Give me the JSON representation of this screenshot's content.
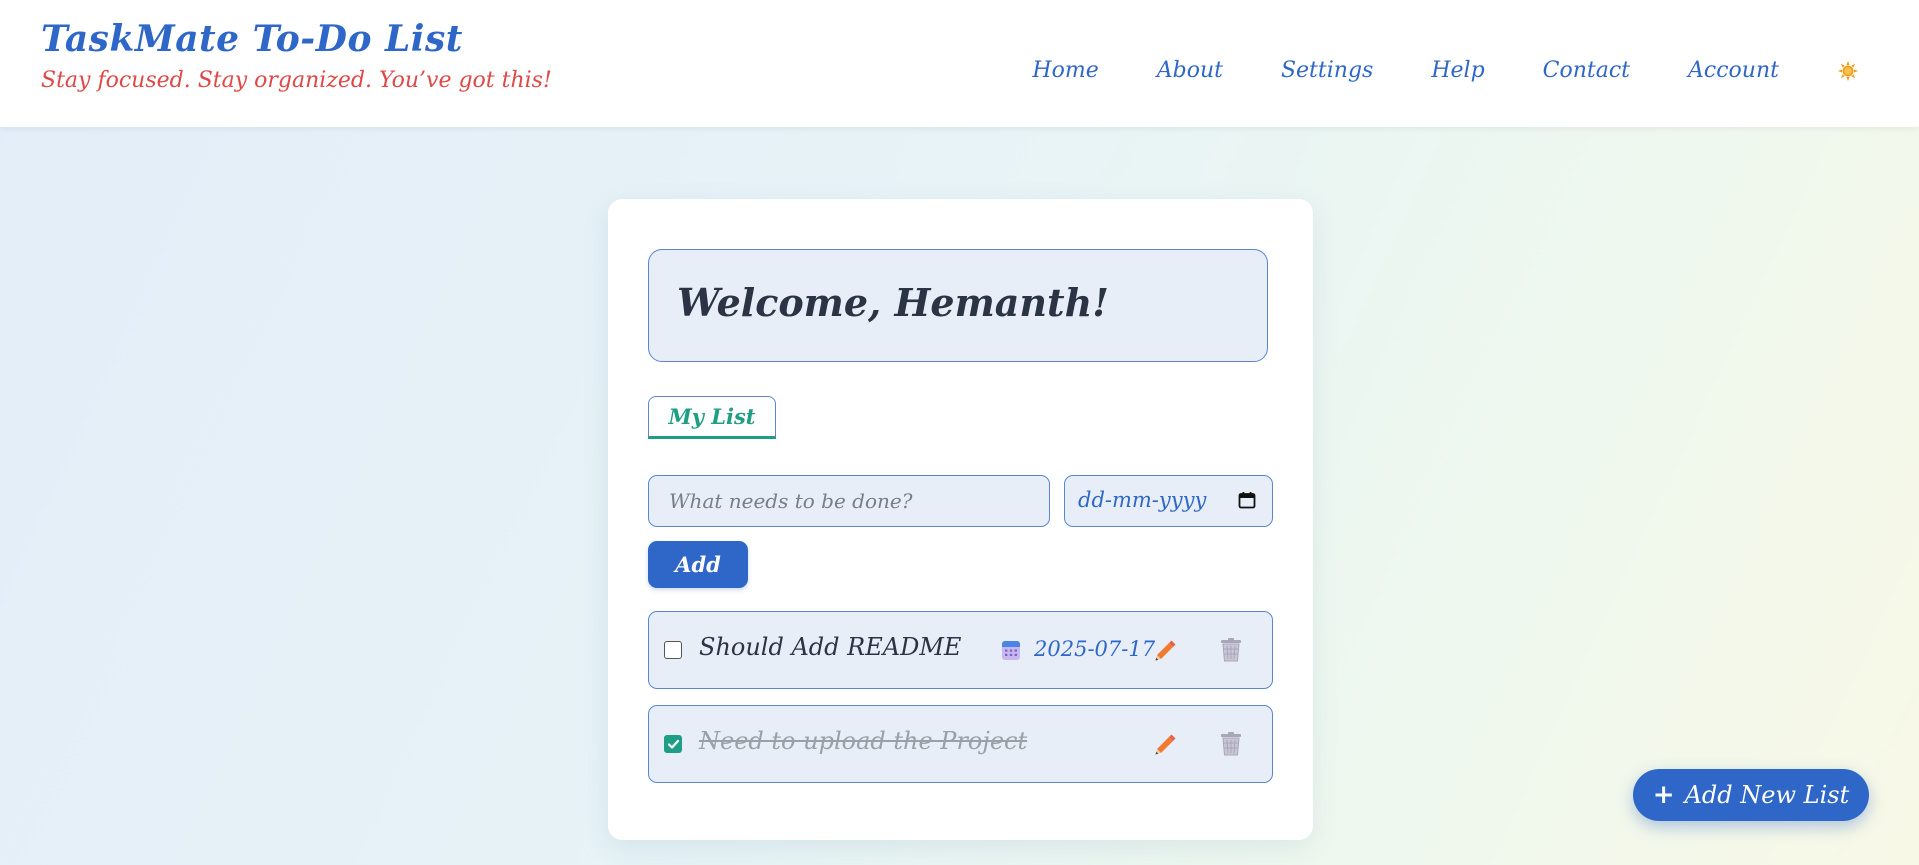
{
  "header": {
    "title": "TaskMate To-Do List",
    "tagline": "Stay focused. Stay organized. You’ve got this!",
    "nav": [
      {
        "label": "Home"
      },
      {
        "label": "About"
      },
      {
        "label": "Settings"
      },
      {
        "label": "Help"
      },
      {
        "label": "Contact"
      },
      {
        "label": "Account"
      }
    ],
    "theme_toggle_icon": "sun-icon"
  },
  "main": {
    "welcome": "Welcome, Hemanth!",
    "tabs": [
      {
        "label": "My List",
        "active": true
      }
    ],
    "new_task": {
      "placeholder": "What needs to be done?",
      "value": ""
    },
    "due_date_input": {
      "placeholder": "dd-mm-yyyy",
      "icon": "calendar-icon"
    },
    "add_label": "Add",
    "tasks": [
      {
        "text": "Should Add README",
        "completed": false,
        "due_date": "2025-07-17",
        "due_icon": "calendar-icon",
        "edit_icon": "pencil-icon",
        "delete_icon": "trash-icon"
      },
      {
        "text": "Need to upload the Project",
        "completed": true,
        "due_date": "",
        "edit_icon": "pencil-icon",
        "delete_icon": "trash-icon"
      }
    ]
  },
  "fab": {
    "icon": "plus-icon",
    "label": "Add New List"
  },
  "colors": {
    "primary": "#2f67c9",
    "accent": "#1f9e86",
    "tagline": "#e04848",
    "field_bg": "#e8eef7"
  }
}
